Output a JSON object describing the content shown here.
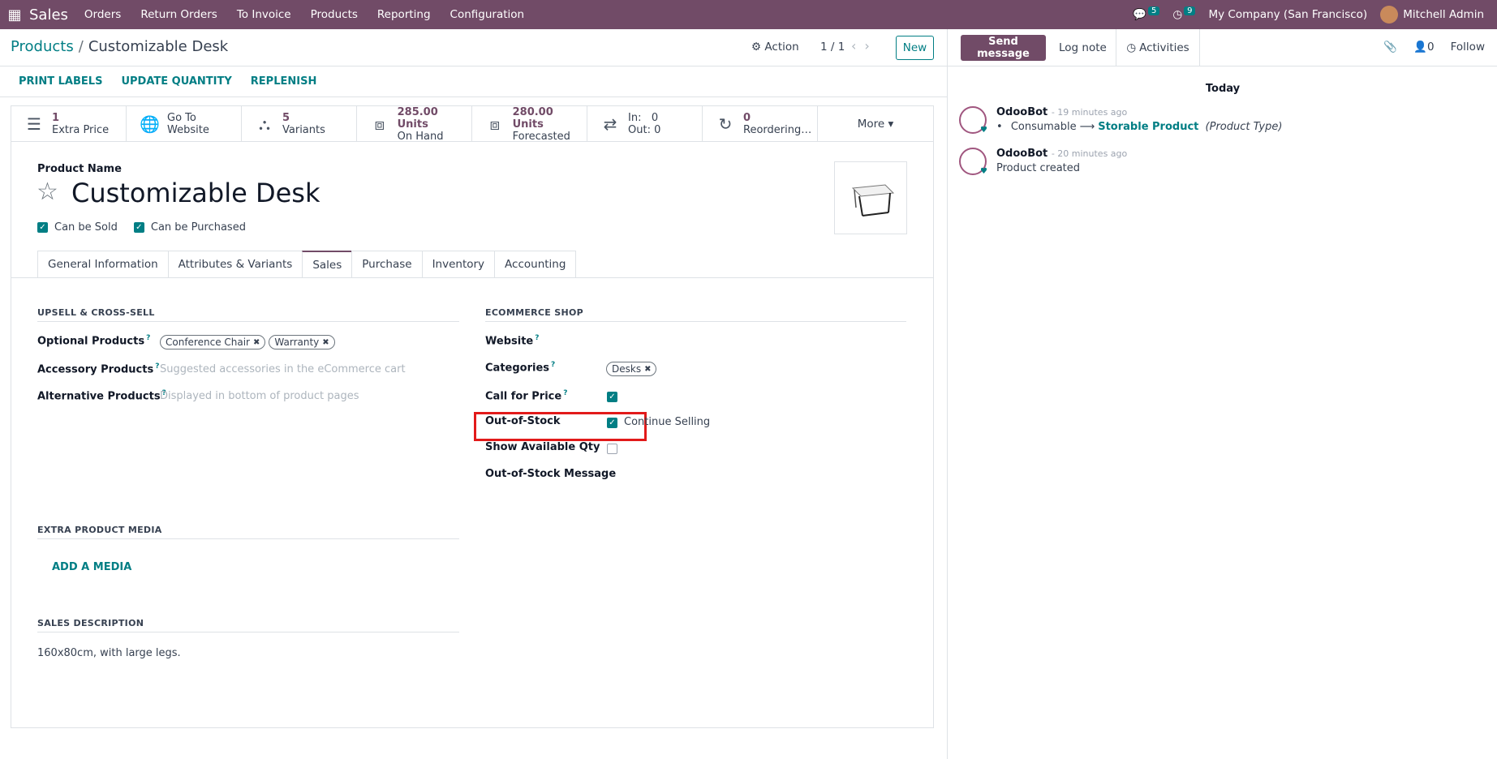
{
  "topbar": {
    "app_name": "Sales",
    "menu": [
      "Orders",
      "Return Orders",
      "To Invoice",
      "Products",
      "Reporting",
      "Configuration"
    ],
    "messages_count": "5",
    "activities_count": "9",
    "company": "My Company (San Francisco)",
    "user": "Mitchell Admin"
  },
  "breadcrumb": {
    "parent": "Products",
    "sep": "/",
    "current": "Customizable Desk"
  },
  "control": {
    "action_label": "Action",
    "pager": "1 / 1",
    "new_label": "New"
  },
  "statusbar": [
    "PRINT LABELS",
    "UPDATE QUANTITY",
    "REPLENISH"
  ],
  "stats": [
    {
      "num": "1",
      "label": "Extra Price",
      "icon": "list-icon"
    },
    {
      "num": "Go To",
      "label": "Website",
      "icon": "globe-icon"
    },
    {
      "num": "5",
      "label": "Variants",
      "icon": "sitemap-icon"
    },
    {
      "num": "285.00 Units",
      "label": "On Hand",
      "icon": "cubes-icon"
    },
    {
      "num": "280.00 Units",
      "label": "Forecasted",
      "icon": "cubes-icon"
    },
    {
      "num": "In:   0",
      "label": "Out: 0",
      "icon": "exchange-icon"
    },
    {
      "num": "0",
      "label": "Reordering…",
      "icon": "refresh-icon"
    }
  ],
  "stats_more": "More ▾",
  "product": {
    "name_label": "Product Name",
    "name": "Customizable Desk",
    "can_be_sold": "Can be Sold",
    "can_be_purchased": "Can be Purchased"
  },
  "tabs": [
    "General Information",
    "Attributes & Variants",
    "Sales",
    "Purchase",
    "Inventory",
    "Accounting"
  ],
  "upsell": {
    "section": "UPSELL & CROSS-SELL",
    "optional_label": "Optional Products",
    "optional_tags": [
      "Conference Chair",
      "Warranty"
    ],
    "accessory_label": "Accessory Products",
    "accessory_placeholder": "Suggested accessories in the eCommerce cart",
    "alternative_label": "Alternative Products",
    "alternative_placeholder": "Displayed in bottom of product pages"
  },
  "ecommerce": {
    "section": "ECOMMERCE SHOP",
    "website_label": "Website",
    "categories_label": "Categories",
    "categories_tags": [
      "Desks"
    ],
    "call_for_price_label": "Call for Price",
    "out_of_stock_label": "Out-of-Stock",
    "continue_selling": "Continue Selling",
    "show_qty_label": "Show Available Qty",
    "oos_message_label": "Out-of-Stock Message"
  },
  "media": {
    "section": "EXTRA PRODUCT MEDIA",
    "add_label": "ADD A MEDIA"
  },
  "sales_desc": {
    "section": "SALES DESCRIPTION",
    "text": "160x80cm, with large legs."
  },
  "chatter": {
    "send_message": "Send message",
    "log_note": "Log note",
    "activities": "Activities",
    "followers_count": "0",
    "follow": "Follow",
    "today": "Today",
    "messages": [
      {
        "author": "OdooBot",
        "time": "- 19 minutes ago",
        "from": "Consumable",
        "to": "Storable Product",
        "field": "(Product Type)"
      },
      {
        "author": "OdooBot",
        "time": "- 20 minutes ago",
        "text": "Product created"
      }
    ]
  }
}
